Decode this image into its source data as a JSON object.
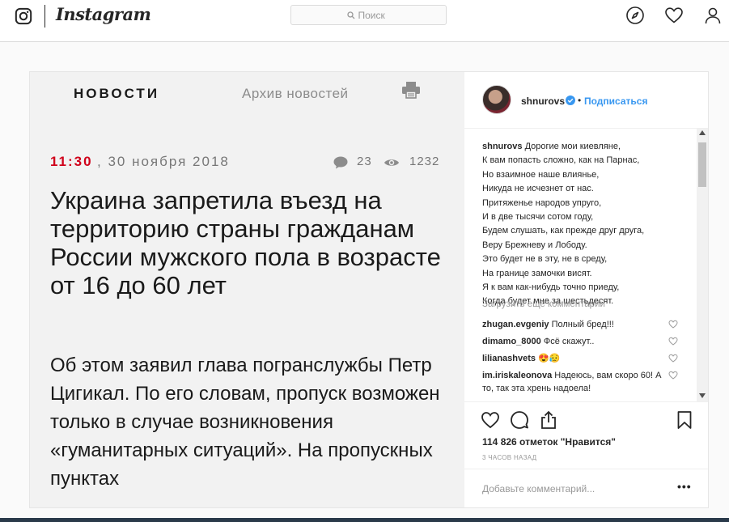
{
  "header": {
    "wordmark": "Instagram",
    "search_placeholder": "Поиск"
  },
  "media": {
    "tab_news": "НОВОСТИ",
    "tab_archive": "Архив новостей",
    "time": "11:30",
    "date": ", 30 ноября 2018",
    "comments_count": "23",
    "views_count": "1232",
    "headline": "Украина запретила въезд на территорию страны гражданам России мужского пола в возрасте от 16 до  60 лет",
    "body": "Об этом заявил глава погранслужбы Петр Цигикал. По его словам, пропуск возможен только в случае возникновения «гуманитарных ситуаций». На пропускных пунктах"
  },
  "post": {
    "username": "shnurovs",
    "dot": "•",
    "follow_label": "Подписаться",
    "caption_user": "shnurovs",
    "caption_lines": [
      "Дорогие мои киевляне,",
      "К вам попасть сложно, как на Парнас,",
      "Но взаимное наше влиянье,",
      "Никуда не исчезнет от нас.",
      "Притяженье народов упруго,",
      "И в две тысячи сотом году,",
      "Будем слушать, как прежде друг друга,",
      "Веру Брежневу и Лободу.",
      "Это будет не в эту, не в среду,",
      "На границе замочки висят.",
      "Я к вам как-нибудь точно приеду,",
      "Когда будет мне за шестьдесят."
    ],
    "load_more": "Загрузить еще комментарии",
    "comments": [
      {
        "user": "zhugan.evgeniy",
        "text": "Полный бред!!!"
      },
      {
        "user": "dimamo_8000",
        "text": "Фсё скажут.."
      },
      {
        "user": "lilianashvets",
        "text": "😍😥"
      },
      {
        "user": "im.iriskaleonova",
        "text": "Надеюсь, вам скоро 60! А то, так эта хрень надоела!"
      }
    ],
    "likes": "114 826 отметок \"Нравится\"",
    "time_ago": "3 ЧАСОВ НАЗАД",
    "add_comment_placeholder": "Добавьте комментарий...",
    "more": "•••"
  },
  "colors": {
    "accent_blue": "#3897f0",
    "news_red": "#d0021b",
    "border": "#dbdbdb"
  }
}
